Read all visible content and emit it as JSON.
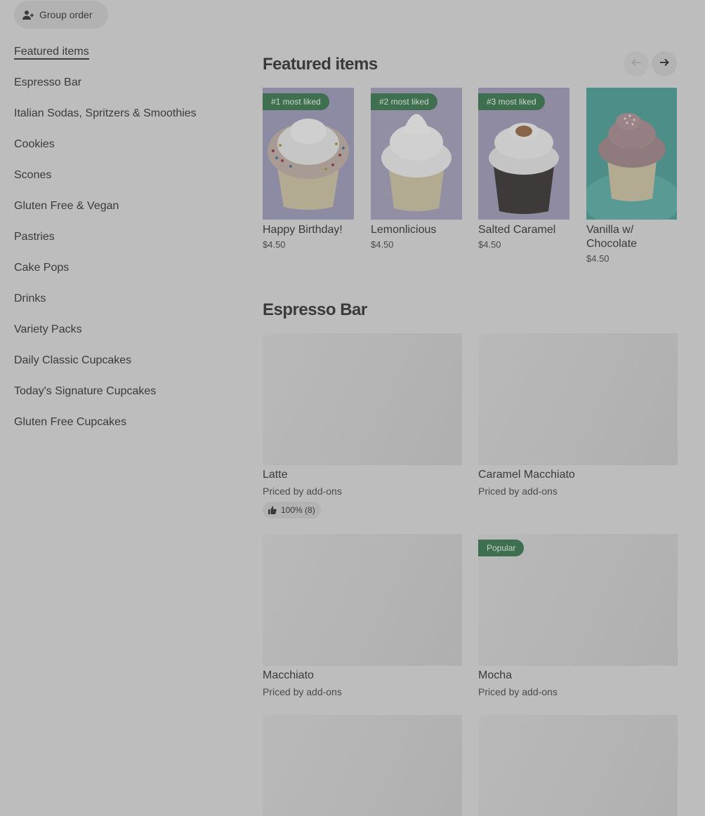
{
  "header": {
    "group_order_label": "Group order"
  },
  "sidebar": {
    "items": [
      {
        "label": "Featured items",
        "active": true
      },
      {
        "label": "Espresso Bar"
      },
      {
        "label": "Italian Sodas, Spritzers & Smoothies"
      },
      {
        "label": "Cookies"
      },
      {
        "label": "Scones"
      },
      {
        "label": "Gluten Free & Vegan"
      },
      {
        "label": "Pastries"
      },
      {
        "label": "Cake Pops"
      },
      {
        "label": "Drinks"
      },
      {
        "label": "Variety Packs"
      },
      {
        "label": "Daily Classic Cupcakes"
      },
      {
        "label": "Today's Signature Cupcakes"
      },
      {
        "label": "Gluten Free Cupcakes"
      }
    ]
  },
  "featured": {
    "title": "Featured items",
    "items": [
      {
        "badge": "#1 most liked",
        "name": "Happy Birthday!",
        "price": "$4.50"
      },
      {
        "badge": "#2 most liked",
        "name": "Lemonlicious",
        "price": "$4.50"
      },
      {
        "badge": "#3 most liked",
        "name": "Salted Caramel",
        "price": "$4.50"
      },
      {
        "badge": "",
        "name": "Vanilla w/ Chocolate",
        "price": "$4.50"
      }
    ]
  },
  "espresso": {
    "title": "Espresso Bar",
    "items": [
      {
        "name": "Latte",
        "sub": "Priced by add-ons",
        "rating": "100% (8)",
        "badge": ""
      },
      {
        "name": "Caramel Macchiato",
        "sub": "Priced by add-ons",
        "rating": "",
        "badge": ""
      },
      {
        "name": "Macchiato",
        "sub": "Priced by add-ons",
        "rating": "",
        "badge": ""
      },
      {
        "name": "Mocha",
        "sub": "Priced by add-ons",
        "rating": "",
        "badge": "Popular"
      },
      {
        "name": "",
        "sub": "",
        "rating": "",
        "badge": ""
      },
      {
        "name": "",
        "sub": "",
        "rating": "",
        "badge": ""
      }
    ]
  },
  "colors": {
    "overlay_bg": "#bdbdbd",
    "badge_green": "#3e6f4f",
    "text": "#3a3a3a"
  }
}
